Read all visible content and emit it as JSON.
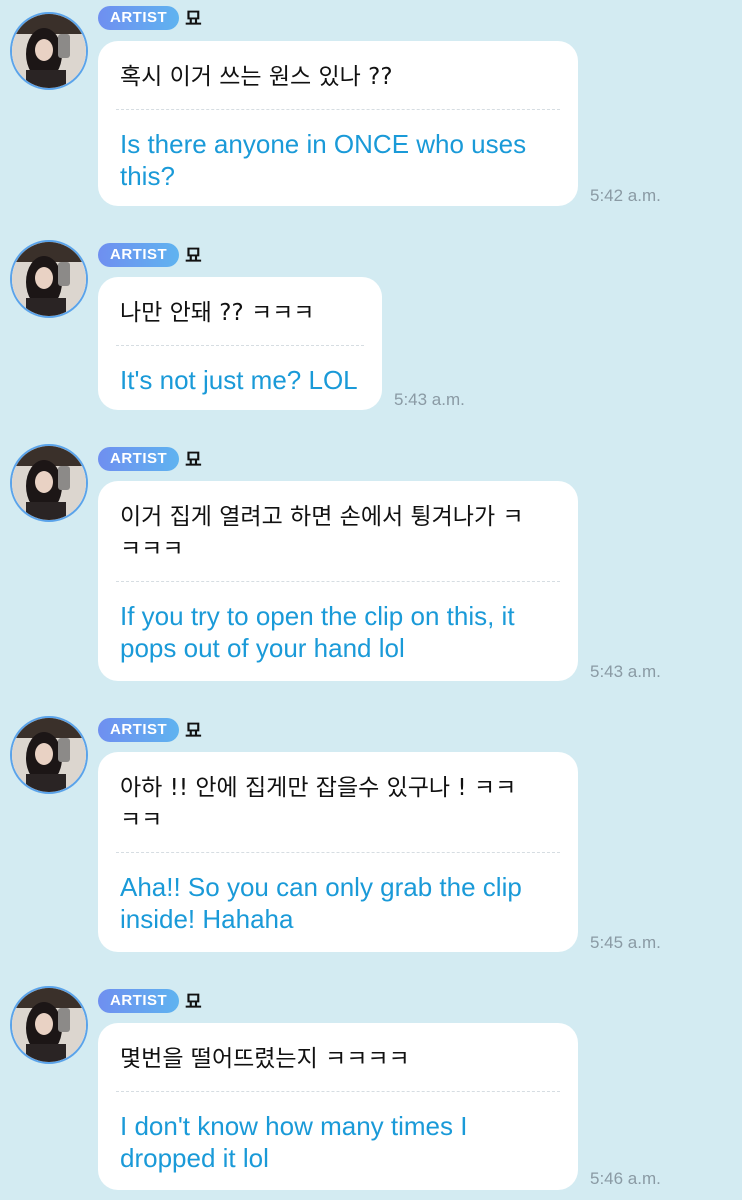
{
  "artist_badge": "ARTIST",
  "artist_name": "묘",
  "messages": [
    {
      "korean": "혹시 이거 쓰는 원스 있나 ??",
      "english": "Is there anyone in ONCE who uses\nthis?",
      "time": "5:42 a.m."
    },
    {
      "korean": "나만 안돼 ?? ㅋㅋㅋ",
      "english": "It's not just me? LOL",
      "time": "5:43 a.m."
    },
    {
      "korean": "이거 집게 열려고 하면 손에서 튕겨나가 ㅋ\nㅋㅋㅋ",
      "english": "If you try to open the clip on this, it\npops out of your hand lol",
      "time": "5:43 a.m."
    },
    {
      "korean": "아하 !! 안에 집게만 잡을수 있구나 ! ㅋㅋ\nㅋㅋ",
      "english": "Aha!! So you can only grab the clip\ninside! Hahaha",
      "time": "5:45 a.m."
    },
    {
      "korean": "몇번을 떨어뜨렸는지 ㅋㅋㅋㅋ",
      "english": "I don't know how many times I\ndropped it lol",
      "time": "5:46 a.m."
    }
  ]
}
